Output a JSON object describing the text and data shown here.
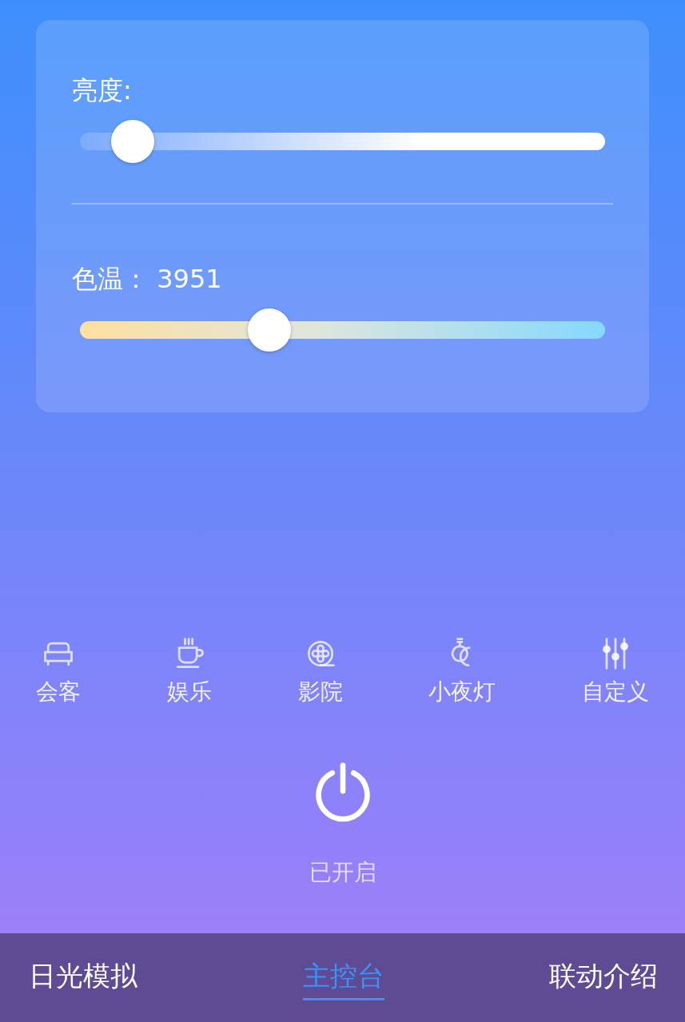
{
  "sliders": [
    {
      "kind": "brightness",
      "label": "亮度:",
      "level": 0.1
    },
    {
      "kind": "temperature",
      "label": "色温：",
      "value": "3951",
      "level": 0.36
    }
  ],
  "scenes": [
    {
      "label": "会客"
    },
    {
      "label": "娱乐"
    },
    {
      "label": "影院"
    },
    {
      "label": "小夜灯"
    },
    {
      "label": "自定义"
    }
  ],
  "power": {
    "on": true,
    "status": "已开启"
  },
  "tabs": [
    {
      "label": "日光模拟",
      "selected": false
    },
    {
      "label": "主控台",
      "selected": true
    },
    {
      "label": "联动介绍",
      "selected": false
    }
  ]
}
